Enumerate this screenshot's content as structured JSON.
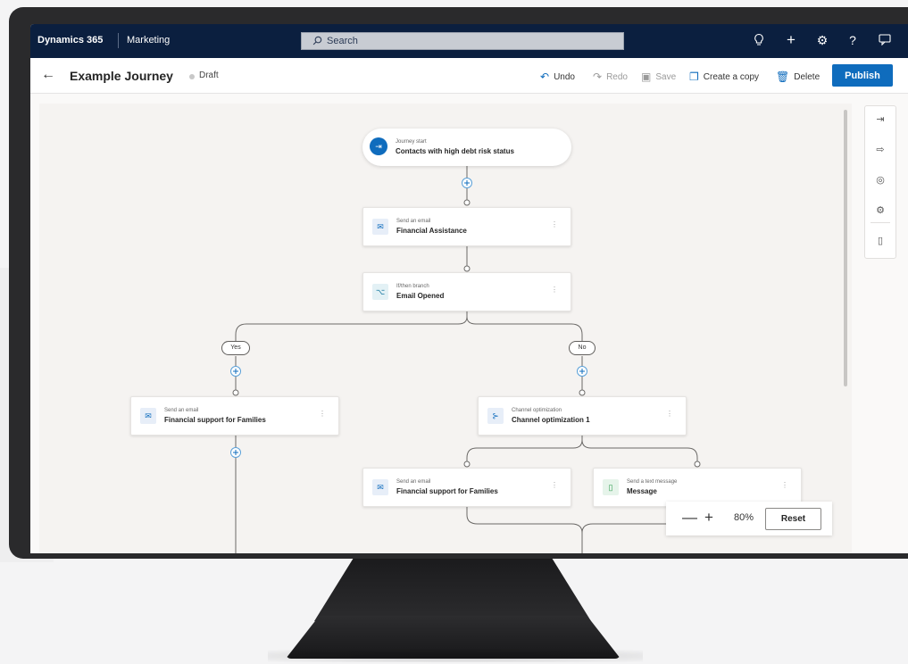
{
  "topbar": {
    "brand": "Dynamics 365",
    "module": "Marketing",
    "search_placeholder": "Search",
    "icons": [
      "lightbulb-icon",
      "plus-icon",
      "settings-icon",
      "help-icon",
      "feedback-icon"
    ]
  },
  "commandbar": {
    "title": "Example Journey",
    "status": "Draft",
    "undo": "Undo",
    "redo": "Redo",
    "save": "Save",
    "create_copy": "Create a copy",
    "delete": "Delete",
    "publish": "Publish"
  },
  "journey": {
    "start": {
      "subtitle": "Journey start",
      "title": "Contacts with high debt risk status"
    },
    "email1": {
      "subtitle": "Send an email",
      "title": "Financial Assistance"
    },
    "ifthen": {
      "subtitle": "If/then branch",
      "title": "Email Opened"
    },
    "yes": "Yes",
    "no": "No",
    "email_yes": {
      "subtitle": "Send an email",
      "title": "Financial support for Families"
    },
    "channel": {
      "subtitle": "Channel optimization",
      "title": "Channel optimization 1"
    },
    "email_ch": {
      "subtitle": "Send an email",
      "title": "Financial support for Families"
    },
    "sms": {
      "subtitle": "Send a text message",
      "title": "Message"
    }
  },
  "zoom": {
    "level": "80%",
    "reset": "Reset"
  },
  "colors": {
    "nav_bg": "#0b1f3f",
    "accent": "#0f6cbd",
    "canvas_bg": "#f5f3f1"
  }
}
